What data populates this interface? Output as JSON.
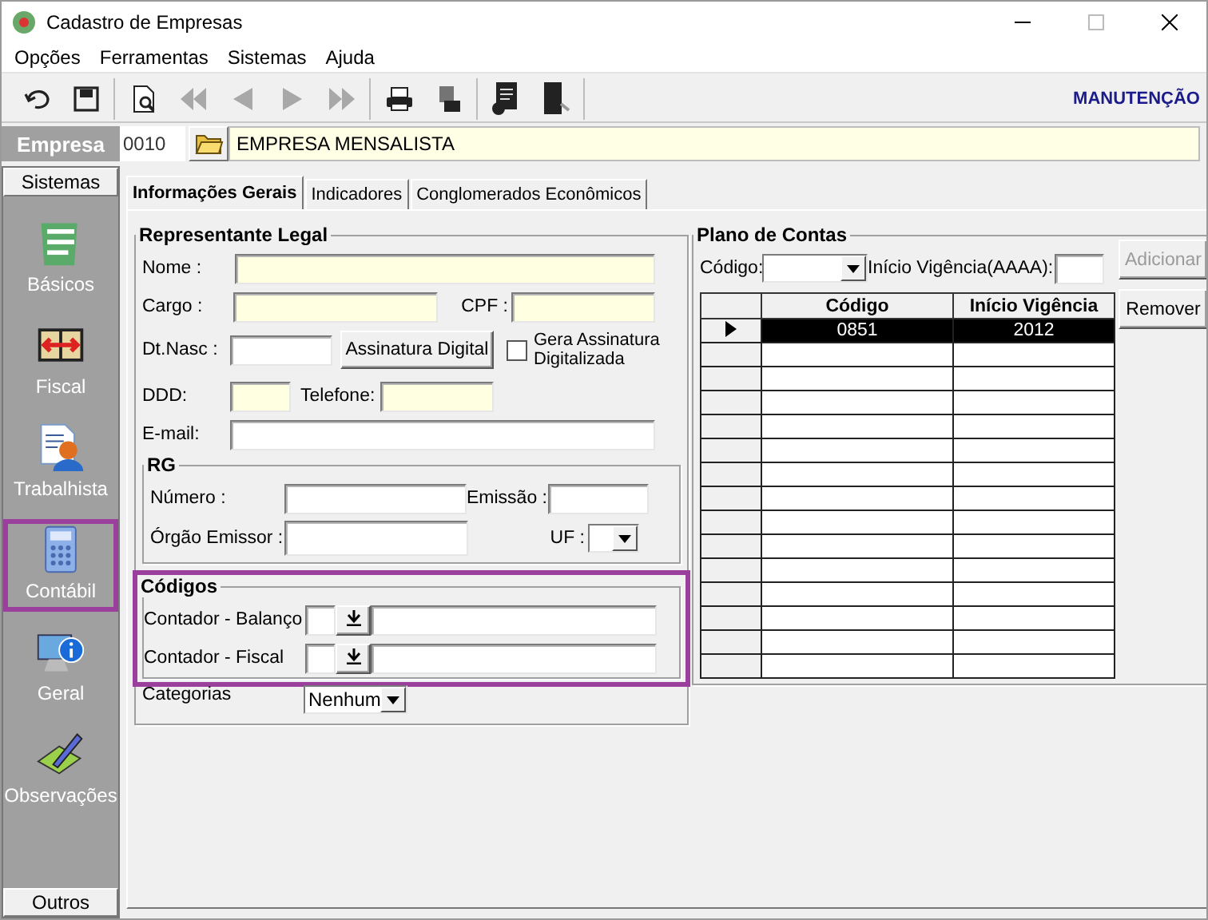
{
  "window": {
    "title": "Cadastro de Empresas"
  },
  "menu": [
    "Opções",
    "Ferramentas",
    "Sistemas",
    "Ajuda"
  ],
  "toolbar": {
    "groups": [
      [
        {
          "disabled": false
        },
        {
          "disabled": false
        }
      ],
      [
        {
          "disabled": false
        },
        {
          "disabled": true
        },
        {
          "disabled": true
        },
        {
          "disabled": true
        },
        {
          "disabled": true
        }
      ],
      [
        {
          "disabled": false
        },
        {
          "disabled": false
        }
      ],
      [
        {
          "disabled": false
        },
        {
          "disabled": false
        }
      ]
    ],
    "mode": "MANUTENÇÃO"
  },
  "company": {
    "label": "Empresa",
    "code": "0010",
    "name": "EMPRESA MENSALISTA"
  },
  "sidebar": {
    "header": "Sistemas",
    "footer": "Outros",
    "items": [
      {
        "label": "Básicos",
        "highlighted": false
      },
      {
        "label": "Fiscal",
        "highlighted": false
      },
      {
        "label": "Trabalhista",
        "highlighted": false
      },
      {
        "label": "Contábil",
        "highlighted": true
      },
      {
        "label": "Geral",
        "highlighted": false
      },
      {
        "label": "Observações",
        "highlighted": false
      }
    ]
  },
  "tabs": [
    {
      "label": "Informações Gerais",
      "selected": true
    },
    {
      "label": "Indicadores",
      "selected": false
    },
    {
      "label": "Conglomerados Econômicos",
      "selected": false
    }
  ],
  "representative": {
    "title": "Representante Legal",
    "name_label": "Nome :",
    "role_label": "Cargo :",
    "cpf_label": "CPF :",
    "birth_label": "Dt.Nasc :",
    "signature_button": "Assinatura Digital",
    "signature_checkbox": {
      "label": "Gera Assinatura Digitalizada",
      "checked": false
    },
    "ddd_label": "DDD:",
    "phone_label": "Telefone:",
    "email_label": "E-mail:",
    "rg": {
      "title": "RG",
      "number_label": "Número :",
      "issue_label": "Emissão :",
      "issuer_label": "Órgão Emissor :",
      "uf_label": "UF :"
    },
    "codes": {
      "title": "Códigos",
      "highlighted": true,
      "rows": [
        "Contador - Balanço",
        "Contador - Fiscal"
      ]
    },
    "categories": {
      "label": "Categorias",
      "value": "Nenhum"
    }
  },
  "accounts": {
    "title": "Plano de Contas",
    "code_label": "Código:",
    "start_label": "Início Vigência(AAAA):",
    "add_button": {
      "label": "Adicionar",
      "disabled": true
    },
    "remove_button": {
      "label": "Remover",
      "disabled": false
    },
    "table": {
      "columns": [
        "Código",
        "Início Vigência"
      ],
      "rows": [
        {
          "cells": [
            "0851",
            "2012"
          ],
          "selected": true
        }
      ]
    }
  }
}
